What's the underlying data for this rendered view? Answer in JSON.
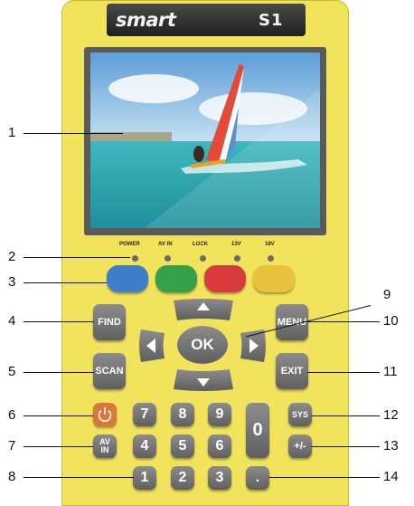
{
  "device": {
    "brand": "smart",
    "model": "S1"
  },
  "leds": [
    "POWER",
    "AV IN",
    "LOCK",
    "13V",
    "18V"
  ],
  "keys": {
    "find": "FIND",
    "scan": "SCAN",
    "menu": "MENU",
    "exit": "EXIT",
    "ok": "OK",
    "sys": "SYS",
    "av_in": "AV IN",
    "plus_minus": "+/-",
    "digits": [
      "7",
      "8",
      "9",
      "4",
      "5",
      "6",
      "1",
      "2",
      "3",
      "0"
    ],
    "dot": "."
  },
  "colors": {
    "body": "#f2e35d",
    "blue_key": "#3d7ec9",
    "green_key": "#35a04a",
    "red_key": "#d8393c",
    "yellow_key": "#e8c23a",
    "power_key": "#d9783a"
  },
  "callouts": [
    "1",
    "2",
    "3",
    "4",
    "5",
    "6",
    "7",
    "8",
    "9",
    "10",
    "11",
    "12",
    "13",
    "14"
  ]
}
